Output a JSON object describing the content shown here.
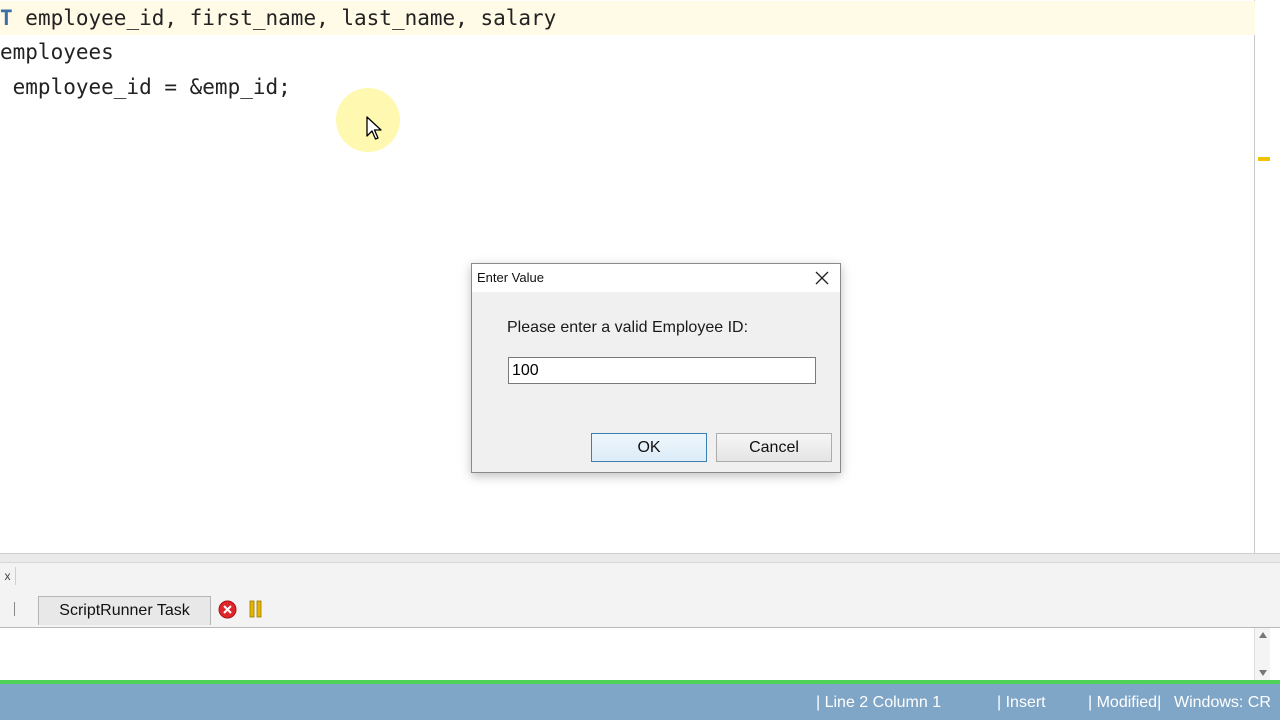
{
  "editor": {
    "lines": [
      {
        "keyword": "T",
        "text": " employee_id, first_name, last_name, salary"
      },
      {
        "text": "employees"
      },
      {
        "text": " employee_id = &emp_id;"
      }
    ]
  },
  "dialog": {
    "title": "Enter Value",
    "prompt": "Please enter a valid Employee ID:",
    "input_value": "100",
    "ok_label": "OK",
    "cancel_label": "Cancel"
  },
  "panel": {
    "close_label": "x",
    "task_tab_label": "ScriptRunner Task"
  },
  "status": {
    "position": "| Line 2 Column 1",
    "mode": "| Insert",
    "modified": "| Modified|",
    "line_ending": "Windows: CR"
  },
  "colors": {
    "statusbar": "#7fa5c7",
    "accent_strip": "#4fd25a",
    "stop": "#e0262a",
    "pause": "#e8b400"
  },
  "icons": {
    "close": "close-icon",
    "stop": "stop-icon",
    "pause": "pause-icon",
    "cursor": "cursor-icon"
  }
}
